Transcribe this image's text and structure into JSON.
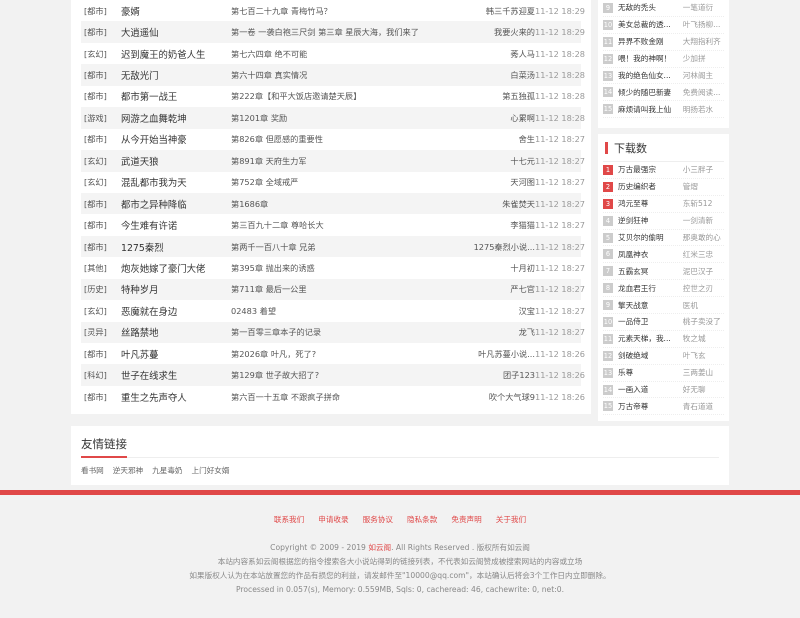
{
  "updates": [
    {
      "cat": "[都市]",
      "title": "豪婿",
      "chapter": "第七百二十九章 青梅竹马？",
      "author": "韩三千苏迎夏",
      "time": "11-12 18:29"
    },
    {
      "cat": "[都市]",
      "title": "大逍遥仙",
      "chapter": "第一卷 一袭白袍三尺剑 第三章 星辰大海，我们来了",
      "author": "我要火来的",
      "time": "11-12 18:29"
    },
    {
      "cat": "[玄幻]",
      "title": "迟到魔王的奶爸人生",
      "chapter": "第七六四章 绝不可能",
      "author": "莠人马",
      "time": "11-12 18:28"
    },
    {
      "cat": "[都市]",
      "title": "无敌光门",
      "chapter": "第六十四章 真实情况",
      "author": "白菜汤",
      "time": "11-12 18:28"
    },
    {
      "cat": "[都市]",
      "title": "都市第一战王",
      "chapter": "第222章【和平大饭店邀请楚天辰】",
      "author": "第五独孤",
      "time": "11-12 18:28"
    },
    {
      "cat": "[游戏]",
      "title": "网游之血舞乾坤",
      "chapter": "第1201章 奖励",
      "author": "心累啊",
      "time": "11-12 18:28"
    },
    {
      "cat": "[都市]",
      "title": "从今开始当神豪",
      "chapter": "第826章 但愿感的重要性",
      "author": "舍生",
      "time": "11-12 18:27"
    },
    {
      "cat": "[玄幻]",
      "title": "武道天狼",
      "chapter": "第891章 天府生力军",
      "author": "十七元",
      "time": "11-12 18:27"
    },
    {
      "cat": "[玄幻]",
      "title": "混乱都市我为天",
      "chapter": "第752章 全域戒严",
      "author": "天河图",
      "time": "11-12 18:27"
    },
    {
      "cat": "[都市]",
      "title": "都市之异种降临",
      "chapter": "第1686章",
      "author": "朱雀焚天",
      "time": "11-12 18:27"
    },
    {
      "cat": "[都市]",
      "title": "今生难有许诺",
      "chapter": "第三百九十二章 尊哈长大",
      "author": "李猫猫",
      "time": "11-12 18:27"
    },
    {
      "cat": "[都市]",
      "title": "1275秦烈",
      "chapter": "第两千一百八十章 兄弟",
      "author": "1275秦烈小说...",
      "time": "11-12 18:27"
    },
    {
      "cat": "[其他]",
      "title": "炮灰她嫁了豪门大佬",
      "chapter": "第395章 抛出来的诱惑",
      "author": "十月初",
      "time": "11-12 18:27"
    },
    {
      "cat": "[历史]",
      "title": "特种岁月",
      "chapter": "第711章 最后一公里",
      "author": "严七官",
      "time": "11-12 18:27"
    },
    {
      "cat": "[玄幻]",
      "title": "恶魔就在身边",
      "chapter": "02483 着望",
      "author": "汉宝",
      "time": "11-12 18:27"
    },
    {
      "cat": "[灵异]",
      "title": "丝路禁地",
      "chapter": "第一百零三章本子的记录",
      "author": "龙飞",
      "time": "11-12 18:27"
    },
    {
      "cat": "[都市]",
      "title": "叶凡苏蔓",
      "chapter": "第2026章 叶凡，死了?",
      "author": "叶凡苏蔓小说...",
      "time": "11-12 18:26"
    },
    {
      "cat": "[科幻]",
      "title": "世子在线求生",
      "chapter": "第129章 世子故大招了?",
      "author": "团子123",
      "time": "11-12 18:26"
    },
    {
      "cat": "[都市]",
      "title": "重生之先声夺人",
      "chapter": "第六百一十五章 不跟疯子拼命",
      "author": "吹个大气球9",
      "time": "11-12 18:26"
    }
  ],
  "hot_rank": {
    "items": [
      {
        "num": "9",
        "name": "无敌的禿头",
        "author": "一笔道衍"
      },
      {
        "num": "10",
        "name": "美女总裁的透...",
        "author": "叶飞扬柳..."
      },
      {
        "num": "11",
        "name": "异界不败金刚",
        "author": "大翔指利齐"
      },
      {
        "num": "12",
        "name": "喂！我的神啊！",
        "author": "少加拼"
      },
      {
        "num": "13",
        "name": "我的绝色仙女...",
        "author": "河林阁主"
      },
      {
        "num": "14",
        "name": "倾少的随巴新妻",
        "author": "免费阅读..."
      },
      {
        "num": "15",
        "name": "麻烦请叫我上仙",
        "author": "明扬若水"
      }
    ]
  },
  "download_rank": {
    "title": "下载数",
    "items": [
      {
        "num": "1",
        "name": "万古最强宗",
        "author": "小三胖子"
      },
      {
        "num": "2",
        "name": "历史编织者",
        "author": "管熠"
      },
      {
        "num": "3",
        "name": "鸿元至尊",
        "author": "东斩512"
      },
      {
        "num": "4",
        "name": "逆剑狂神",
        "author": "一剑清新"
      },
      {
        "num": "5",
        "name": "艾贝尔的偷明",
        "author": "那奥敢的心"
      },
      {
        "num": "6",
        "name": "凤凰神衣",
        "author": "红米三忠"
      },
      {
        "num": "7",
        "name": "五霸玄冥",
        "author": "泥巴汉子"
      },
      {
        "num": "8",
        "name": "龙血君王行",
        "author": "控世之刃"
      },
      {
        "num": "9",
        "name": "擎天战意",
        "author": "医机"
      },
      {
        "num": "10",
        "name": "一品侍卫",
        "author": "桃子卖没了"
      },
      {
        "num": "11",
        "name": "元素天梯，我...",
        "author": "牧之城"
      },
      {
        "num": "12",
        "name": "剑破绝域",
        "author": "叶飞玄"
      },
      {
        "num": "13",
        "name": "乐尊",
        "author": "三两姜山"
      },
      {
        "num": "14",
        "name": "一画入道",
        "author": "好无聊"
      },
      {
        "num": "15",
        "name": "万古帝尊",
        "author": "青石道道"
      }
    ]
  },
  "friend_links": {
    "title": "友情链接",
    "items": [
      "看书网",
      "逆天邪神",
      "九星毒奶",
      "上门好女婿"
    ]
  },
  "footer": {
    "nav": [
      "联系我们",
      "申请收录",
      "服务协议",
      "隐私条款",
      "免责声明",
      "关于我们"
    ],
    "copyright_prefix": "Copyright © 2009 - 2019 ",
    "site_name": "如云阁",
    "copyright_suffix": ". All Rights Reserved . 版权所有如云阁",
    "line2": "本站内容系如云阁根据您的指令搜索各大小说站得到的链接列表，不代表如云阁赞成被搜索网站的内容或立场",
    "line3": "如果版权人认为在本站放置您的作品有损您的利益，请发邮件至\"10000@qq.com\"，本站确认后将会3个工作日内立即删除。",
    "line4": "Processed in 0.057(s), Memory: 0.559MB, Sqls: 0, cacheread: 46, cachewrite: 0, net:0."
  },
  "colors": {
    "accent": "#e04848",
    "rank_default": "#cccccc",
    "row_alt": "#f4f4f4"
  }
}
